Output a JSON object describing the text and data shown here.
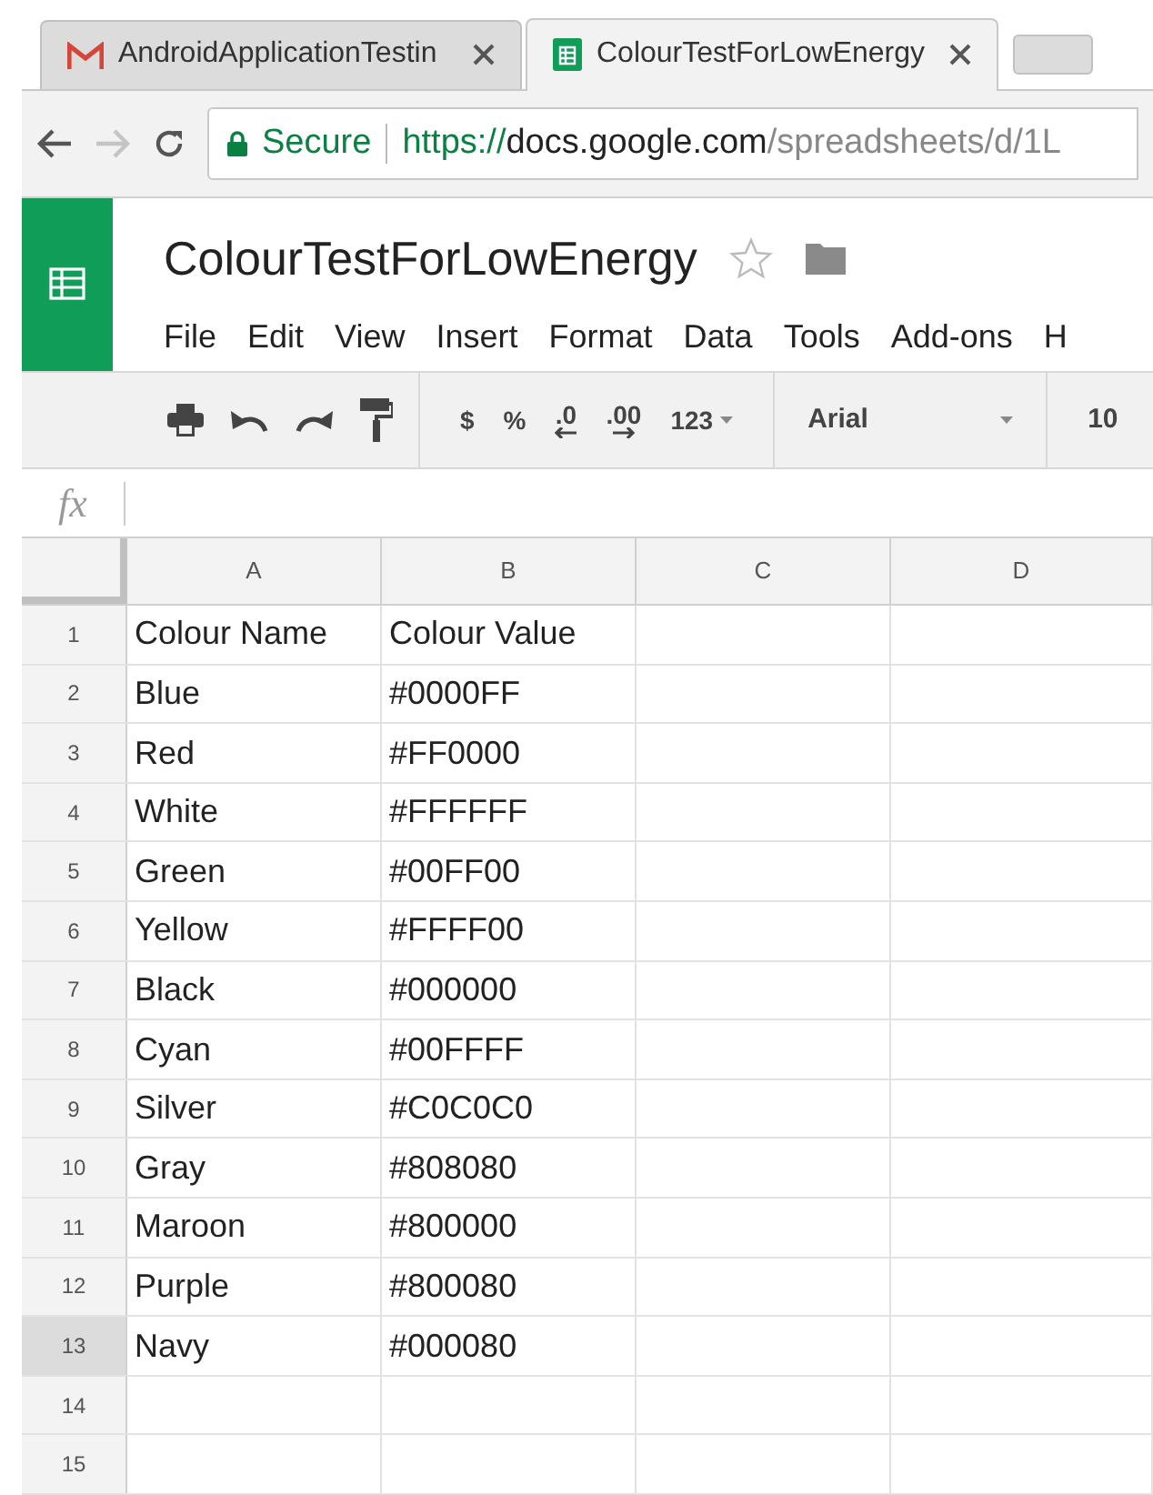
{
  "browser_tabs": [
    {
      "kind": "mail",
      "title": "AndroidApplicationTestin",
      "selected": false
    },
    {
      "kind": "sheet",
      "title": "ColourTestForLowEnergy",
      "selected": true
    }
  ],
  "address_bar": {
    "secure_label": "Secure",
    "url_parts": [
      {
        "kind": "scheme",
        "text": "https://"
      },
      {
        "kind": "host",
        "text": "docs.google.com"
      },
      {
        "kind": "path",
        "text": "/spreadsheets/d/1L"
      }
    ]
  },
  "document": {
    "title": "ColourTestForLowEnergy",
    "starred": false
  },
  "menu": [
    "File",
    "Edit",
    "View",
    "Insert",
    "Format",
    "Data",
    "Tools",
    "Add-ons",
    "H"
  ],
  "toolbar": {
    "currency": "$",
    "percent": "%",
    "decrease_decimals": ".0",
    "increase_decimals": ".00",
    "number_format": "123",
    "font": "Arial",
    "font_size": "10"
  },
  "formula_bar": {
    "label": "fx"
  },
  "sheet": {
    "columns": [
      "A",
      "B",
      "C",
      "D"
    ],
    "rows": [
      {
        "number": "1",
        "selected": false,
        "cells": [
          "Colour Name",
          "Colour Value"
        ]
      },
      {
        "number": "2",
        "selected": false,
        "cells": [
          "Blue",
          "#0000FF"
        ]
      },
      {
        "number": "3",
        "selected": false,
        "cells": [
          "Red",
          "#FF0000"
        ]
      },
      {
        "number": "4",
        "selected": false,
        "cells": [
          "White",
          "#FFFFFF"
        ]
      },
      {
        "number": "5",
        "selected": false,
        "cells": [
          "Green",
          "#00FF00"
        ]
      },
      {
        "number": "6",
        "selected": false,
        "cells": [
          "Yellow",
          "#FFFF00"
        ]
      },
      {
        "number": "7",
        "selected": false,
        "cells": [
          "Black",
          "#000000"
        ]
      },
      {
        "number": "8",
        "selected": false,
        "cells": [
          "Cyan",
          "#00FFFF"
        ]
      },
      {
        "number": "9",
        "selected": false,
        "cells": [
          "Silver",
          "#C0C0C0"
        ]
      },
      {
        "number": "10",
        "selected": false,
        "cells": [
          "Gray",
          "#808080"
        ]
      },
      {
        "number": "11",
        "selected": false,
        "cells": [
          "Maroon",
          "#800000"
        ]
      },
      {
        "number": "12",
        "selected": false,
        "cells": [
          "Purple",
          "#800080"
        ]
      },
      {
        "number": "13",
        "selected": true,
        "cells": [
          "Navy",
          "#000080"
        ]
      },
      {
        "number": "14",
        "selected": false,
        "cells": []
      },
      {
        "number": "15",
        "selected": false,
        "cells": []
      }
    ]
  }
}
